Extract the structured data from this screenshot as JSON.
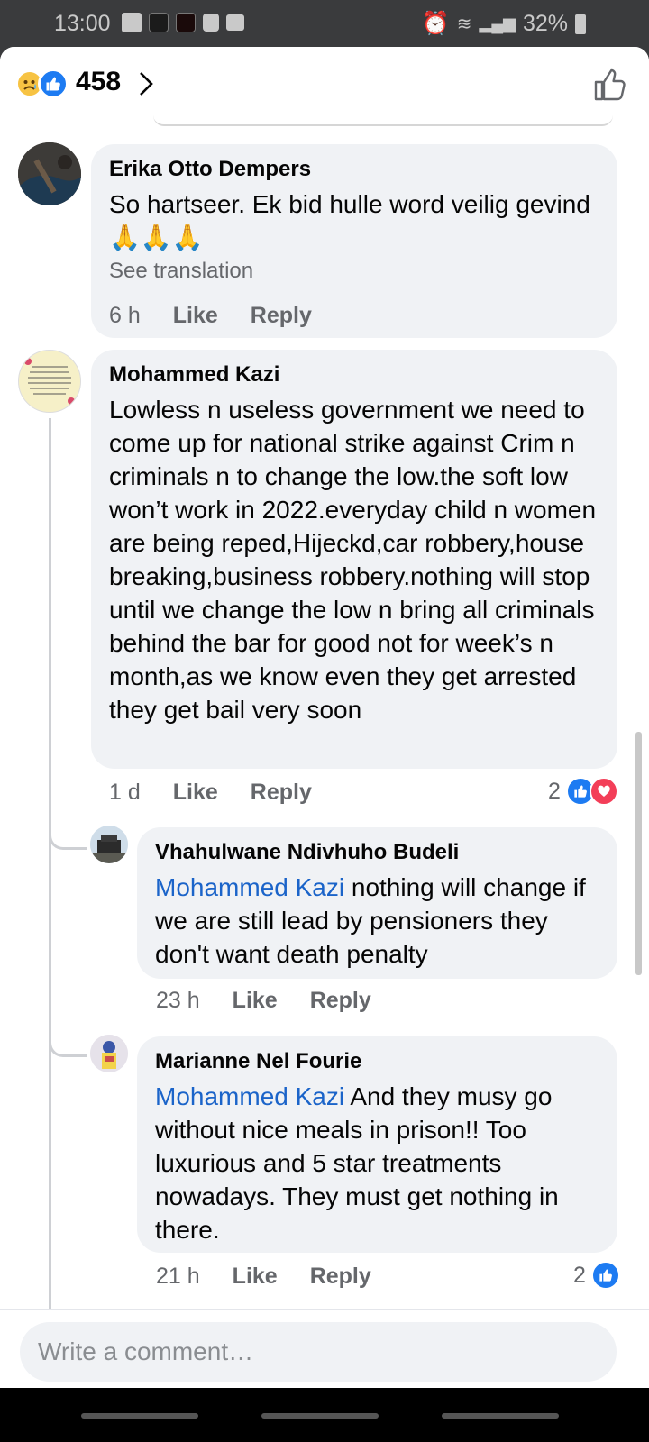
{
  "status_bar": {
    "time": "13:00",
    "battery": "32%"
  },
  "reactions": {
    "count": "458"
  },
  "comments": [
    {
      "name": "Erika Otto Dempers",
      "text": "So hartseer. Ek bid hulle word veilig gevind🙏🙏🙏",
      "see_translation": "See translation",
      "time": "6 h",
      "like": "Like",
      "reply": "Reply"
    },
    {
      "name": "Mohammed Kazi",
      "text": "Lowless n useless government we need to come up for national strike against Crim n criminals n to change the low.the soft low won’t work in 2022.everyday child n women are being reped,Hijeckd,car robbery,house breaking,business robbery.nothing will stop until we change the low n bring all criminals behind the bar for good not for week’s n month,as we know even they get arrested they get bail very soon",
      "time": "1 d",
      "like": "Like",
      "reply": "Reply",
      "reaction_count": "2"
    }
  ],
  "replies": [
    {
      "name": "Vhahulwane Ndivhuho Budeli",
      "mention": "Mohammed Kazi",
      "text": " nothing will change if we are still lead by pensioners they don't want death penalty",
      "time": "23 h",
      "like": "Like",
      "reply": "Reply"
    },
    {
      "name": "Marianne Nel Fourie",
      "mention": "Mohammed Kazi",
      "text": " And they musy go without nice meals in prison!! Too luxurious and 5 star treatments nowadays. They must get nothing in there.",
      "time": "21 h",
      "like": "Like",
      "reply": "Reply",
      "reaction_count": "2"
    }
  ],
  "composer": {
    "placeholder": "Write a comment…"
  },
  "colors": {
    "like_blue": "#1d7bf2",
    "love_red": "#f33e58",
    "mention_blue": "#1b64c9",
    "bubble_bg": "#f0f2f5"
  }
}
